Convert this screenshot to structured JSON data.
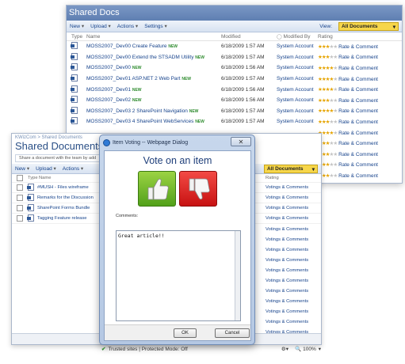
{
  "docs_window": {
    "title": "Shared Docs",
    "toolbar": {
      "new": "New",
      "upload": "Upload",
      "actions": "Actions",
      "settings": "Settings",
      "view_label": "View:",
      "view_value": "All Documents"
    },
    "columns": {
      "type": "Type",
      "name": "Name",
      "modified": "Modified",
      "modified_by": "Modified By",
      "rating": "Rating"
    },
    "new_badge": "NEW",
    "rate_label": "Rate & Comment",
    "rows": [
      {
        "name": "MOSS2007_Dev00 Create Feature",
        "is_new": true,
        "modified": "6/18/2009 1:57 AM",
        "by": "System Account",
        "stars": 3
      },
      {
        "name": "MOSS2007_Dev00 Extend the STSADM Utility",
        "is_new": true,
        "modified": "6/18/2009 1:57 AM",
        "by": "System Account",
        "stars": 3
      },
      {
        "name": "MOSS2007_Dev00",
        "is_new": true,
        "modified": "6/18/2009 1:56 AM",
        "by": "System Account",
        "stars": 4
      },
      {
        "name": "MOSS2007_Dev01 ASP.NET 2 Web Part",
        "is_new": true,
        "modified": "6/18/2009 1:57 AM",
        "by": "System Account",
        "stars": 4
      },
      {
        "name": "MOSS2007_Dev01",
        "is_new": true,
        "modified": "6/18/2009 1:56 AM",
        "by": "System Account",
        "stars": 4
      },
      {
        "name": "MOSS2007_Dev02",
        "is_new": true,
        "modified": "6/18/2009 1:56 AM",
        "by": "System Account",
        "stars": 3
      },
      {
        "name": "MOSS2007_Dev03 2 SharePoint Navigation",
        "is_new": true,
        "modified": "6/18/2009 1:57 AM",
        "by": "System Account",
        "stars": 4
      },
      {
        "name": "MOSS2007_Dev03 4 SharePoint WebServices",
        "is_new": true,
        "modified": "6/18/2009 1:57 AM",
        "by": "System Account",
        "stars": 3
      },
      {
        "name": "",
        "is_new": false,
        "modified": "",
        "by": "",
        "stars": 4
      },
      {
        "name": "",
        "is_new": false,
        "modified": "",
        "by": "",
        "stars": 3
      },
      {
        "name": "",
        "is_new": false,
        "modified": "",
        "by": "",
        "stars": 3
      },
      {
        "name": "",
        "is_new": false,
        "modified": "",
        "by": "",
        "stars": 3
      },
      {
        "name": "",
        "is_new": false,
        "modified": "",
        "by": "",
        "stars": 3
      }
    ]
  },
  "kw_window": {
    "breadcrumb": "KWizCom > Shared Documents",
    "title": "Shared Documents",
    "description": "Share a document with the team by add",
    "toolbar": {
      "new": "New",
      "upload": "Upload",
      "actions": "Actions",
      "view_value": "All Documents"
    },
    "columns": {
      "type": "Type",
      "name": "Name",
      "rating": "Rating"
    },
    "rows": [
      {
        "name": "#MUSH - Files wireframe",
        "vote": "Votings & Comments"
      },
      {
        "name": "Remarks for the Discussion",
        "vote": "Votings & Comments"
      },
      {
        "name": "SharePoint Forms Bundle",
        "vote": "Votings & Comments"
      },
      {
        "name": "Tagging Feature release",
        "vote": "Votings & Comments"
      }
    ],
    "extra_vote_rows": [
      "Votings & Comments",
      "Votings & Comments",
      "Votings & Comments",
      "Votings & Comments",
      "Votings & Comments",
      "Votings & Comments",
      "Votings & Comments",
      "Votings & Comments",
      "Votings & Comments",
      "Votings & Comments",
      "Votings & Comments",
      "Votings & Comments"
    ]
  },
  "dialog": {
    "title": "Item Voting -- Webpage Dialog",
    "close_glyph": "✕",
    "heading": "Vote on an item",
    "comments_label": "Comments:",
    "comments_value": "Great article!!",
    "ok_label": "OK",
    "cancel_label": "Cancel"
  },
  "status_bar": {
    "zone": "Trusted sites | Protected Mode: Off",
    "zoom": "100%"
  },
  "colors": {
    "vote_up": "#52a11a",
    "vote_down": "#c71212",
    "star": "#e6a400",
    "view_highlight": "#f6d64a"
  }
}
